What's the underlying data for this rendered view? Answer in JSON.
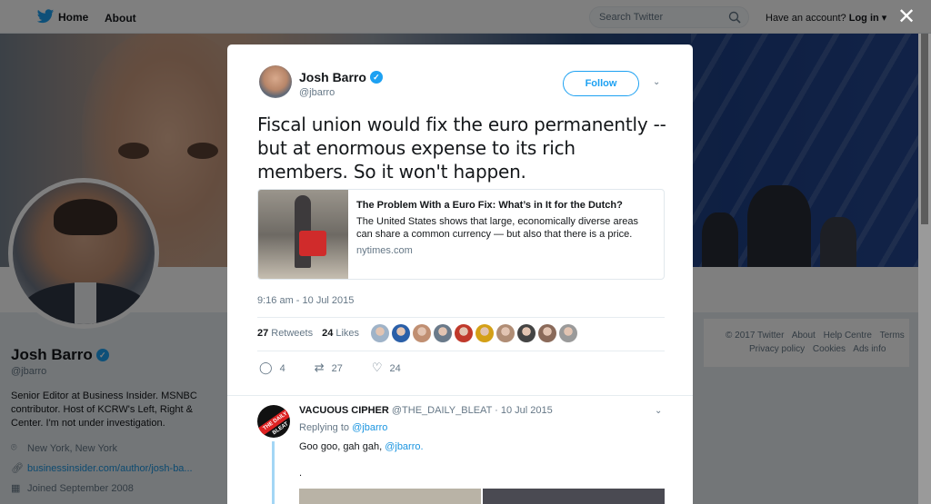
{
  "topbar": {
    "home_label": "Home",
    "about_label": "About",
    "search_placeholder": "Search Twitter",
    "have_account_text": "Have an account?",
    "login_label": "Log in"
  },
  "profile": {
    "name": "Josh Barro",
    "handle": "@jbarro",
    "bio": "Senior Editor at Business Insider. MSNBC contributor. Host of KCRW's Left, Right & Center. I'm not under investigation.",
    "location": "New York, New York",
    "website": "businessinsider.com/author/josh-ba...",
    "joined": "Joined September 2008"
  },
  "footer": {
    "items_row1": [
      "© 2017 Twitter",
      "About",
      "Help Centre",
      "Terms"
    ],
    "items_row2": [
      "Privacy policy",
      "Cookies",
      "Ads info"
    ]
  },
  "tweet": {
    "author_name": "Josh Barro",
    "author_handle": "@jbarro",
    "follow_label": "Follow",
    "text": "Fiscal union would fix the euro permanently -- but at enormous expense to its rich members. So it won't happen.",
    "card": {
      "title": "The Problem With a Euro Fix: What’s in It for the Dutch?",
      "description": "The United States shows that large, economically diverse areas can share a common currency — but also that there is a price.",
      "domain": "nytimes.com"
    },
    "timestamp": "9:16 am - 10 Jul 2015",
    "retweets_count": "27",
    "retweets_label": "Retweets",
    "likes_count": "24",
    "likes_label": "Likes",
    "likers_colors": [
      "#9fb3c8",
      "#2a5fa8",
      "#c08f72",
      "#6a7a8a",
      "#c0392b",
      "#d4a017",
      "#b08d75",
      "#444444",
      "#8a6a5a",
      "#9a9a9a"
    ],
    "actions": {
      "reply_count": "4",
      "retweet_count": "27",
      "like_count": "24"
    }
  },
  "reply": {
    "author_name": "VACUOUS CIPHER",
    "author_handle": "@THE_DAILY_BLEAT",
    "date": "10 Jul 2015",
    "avatar_text": "THE DAILY BLEAT",
    "replying_to_label": "Replying to",
    "replying_to_handle": "@jbarro",
    "text": "Goo goo, gah gah,",
    "mention": "@jbarro.",
    "dot": "."
  },
  "colors": {
    "accent": "#1da1f2",
    "link": "#1b95e0",
    "muted": "#657786"
  }
}
